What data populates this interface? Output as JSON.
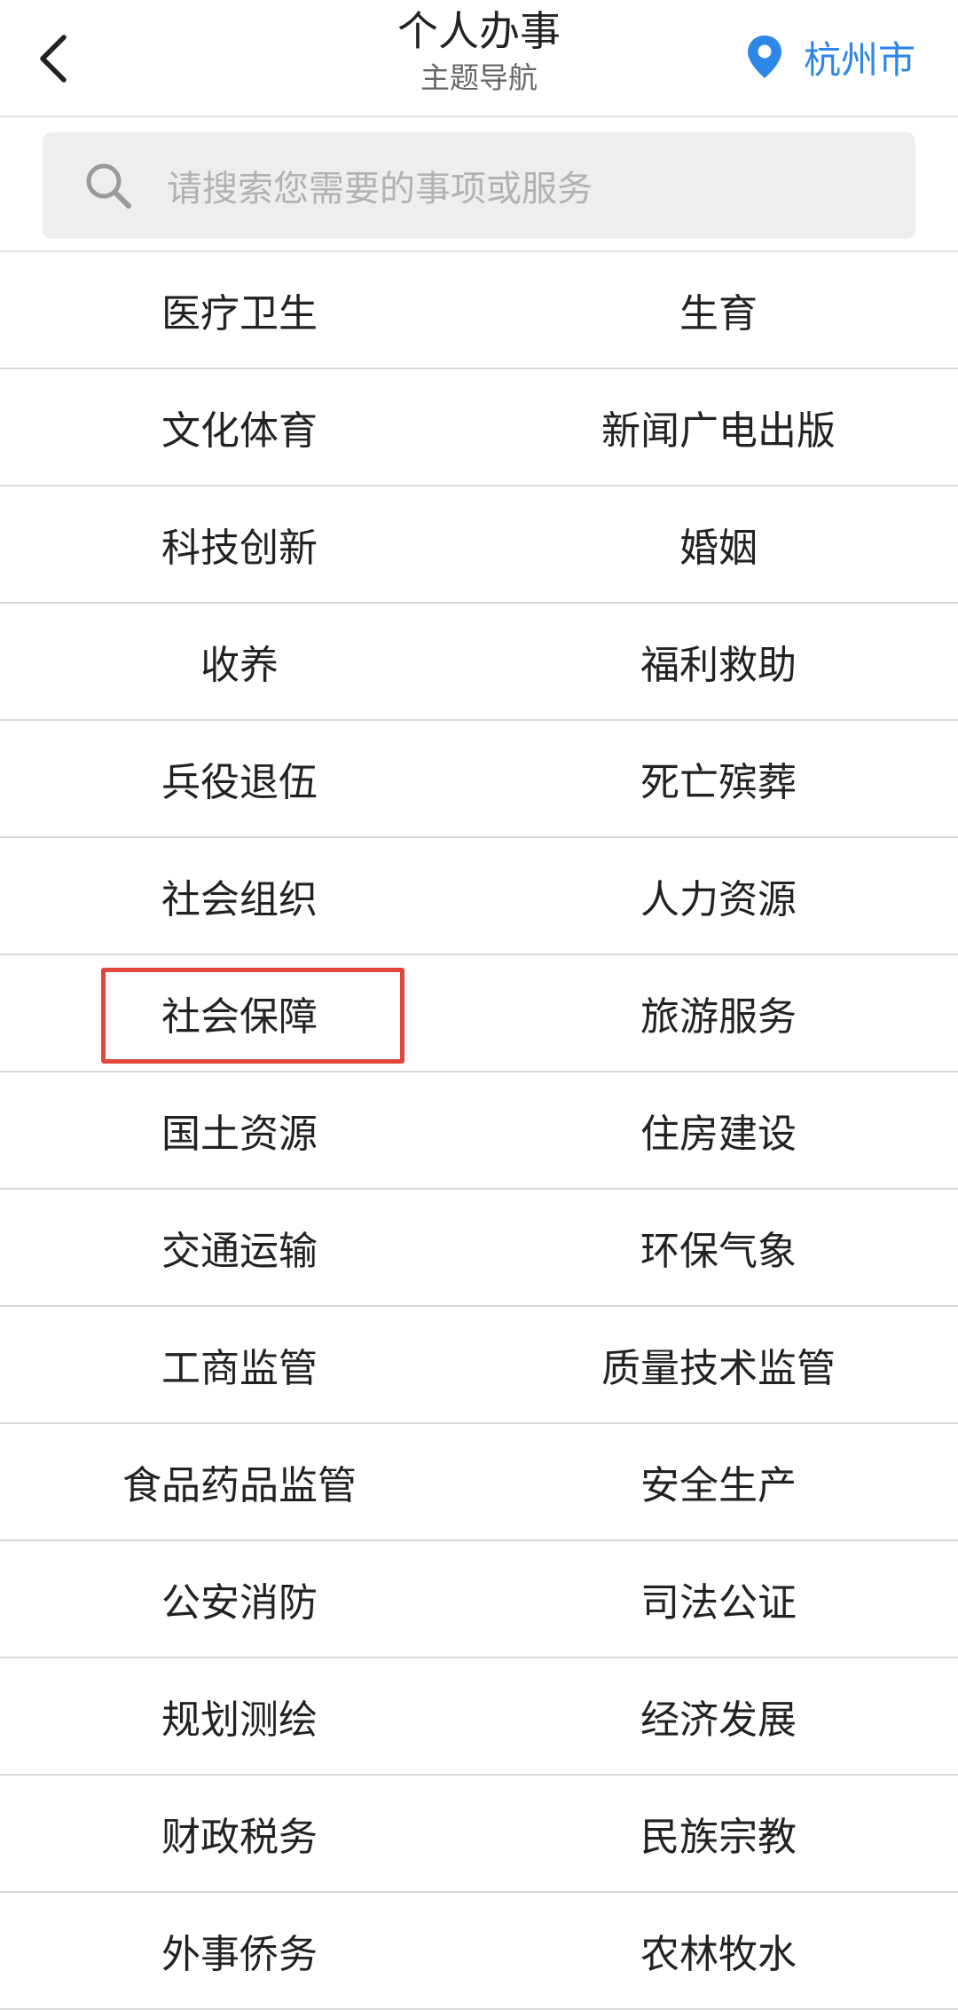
{
  "header": {
    "title": "个人办事",
    "subtitle": "主题导航",
    "location": "杭州市",
    "accent_color": "#2c87e6",
    "back_icon": "chevron-left-icon",
    "location_icon": "map-pin-icon"
  },
  "search": {
    "placeholder": "请搜索您需要的事项或服务",
    "icon": "search-icon"
  },
  "highlight_color": "#e0473a",
  "categories": [
    [
      "医疗卫生",
      "生育"
    ],
    [
      "文化体育",
      "新闻广电出版"
    ],
    [
      "科技创新",
      "婚姻"
    ],
    [
      "收养",
      "福利救助"
    ],
    [
      "兵役退伍",
      "死亡殡葬"
    ],
    [
      "社会组织",
      "人力资源"
    ],
    [
      "社会保障",
      "旅游服务"
    ],
    [
      "国土资源",
      "住房建设"
    ],
    [
      "交通运输",
      "环保气象"
    ],
    [
      "工商监管",
      "质量技术监管"
    ],
    [
      "食品药品监管",
      "安全生产"
    ],
    [
      "公安消防",
      "司法公证"
    ],
    [
      "规划测绘",
      "经济发展"
    ],
    [
      "财政税务",
      "民族宗教"
    ],
    [
      "外事侨务",
      "农林牧水"
    ]
  ],
  "highlighted": "社会保障"
}
